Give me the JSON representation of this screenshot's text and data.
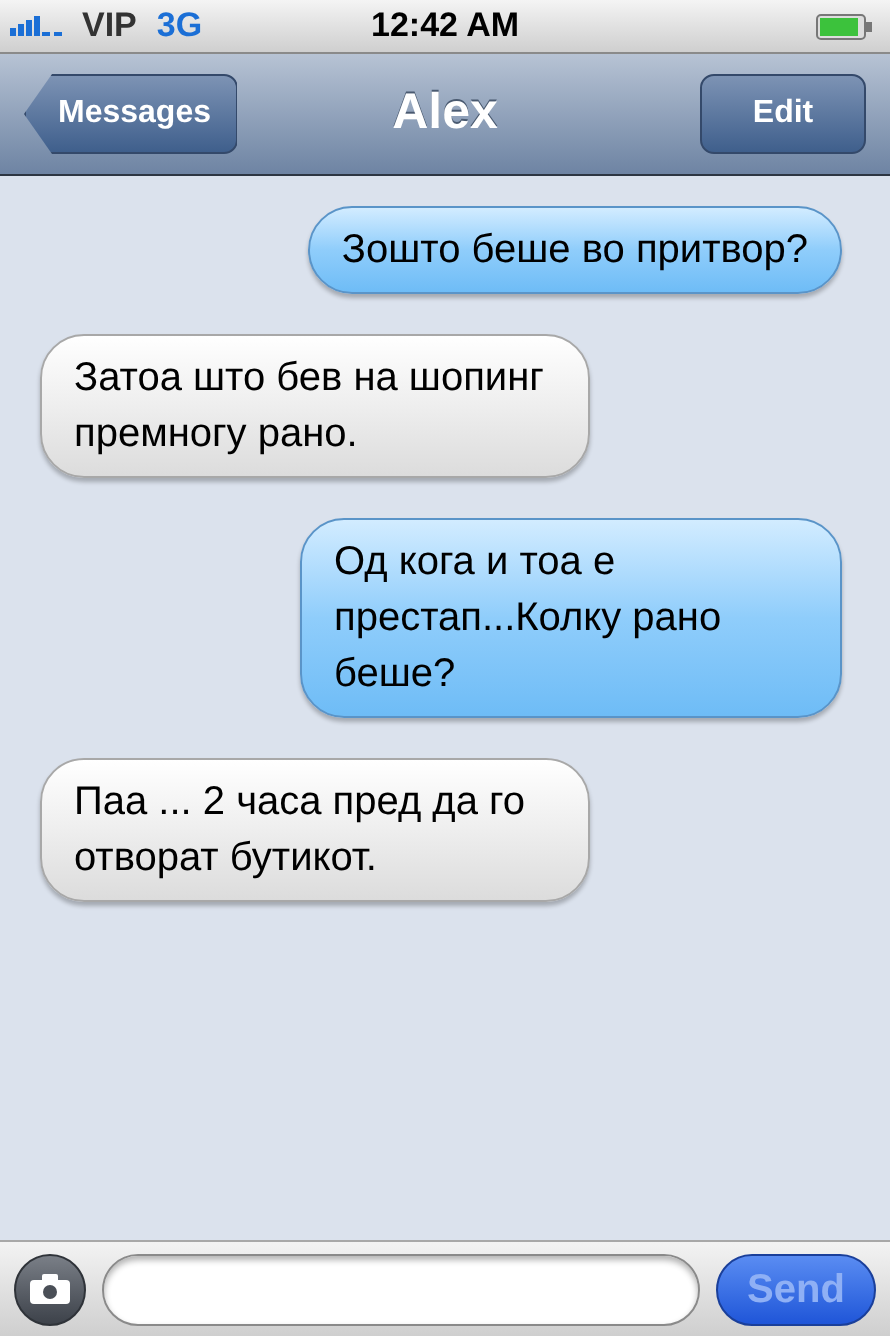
{
  "status_bar": {
    "carrier": "VIP",
    "network": "3G",
    "time": "12:42 AM"
  },
  "nav_bar": {
    "back_button": "Messages",
    "title": "Alex",
    "edit_button": "Edit"
  },
  "messages": [
    {
      "kind": "sent",
      "text": "Зошто беше во притвор?"
    },
    {
      "kind": "received",
      "text": "Затоа што бев на шопинг премногу рано."
    },
    {
      "kind": "sent",
      "text": "Од кога и тоа е престап...Колку рано беше?"
    },
    {
      "kind": "received",
      "text": "Паа ... 2 часа пред да го отворат бутикот."
    }
  ],
  "input_bar": {
    "send_button": {
      "label": "Send",
      "disabled": true
    }
  }
}
